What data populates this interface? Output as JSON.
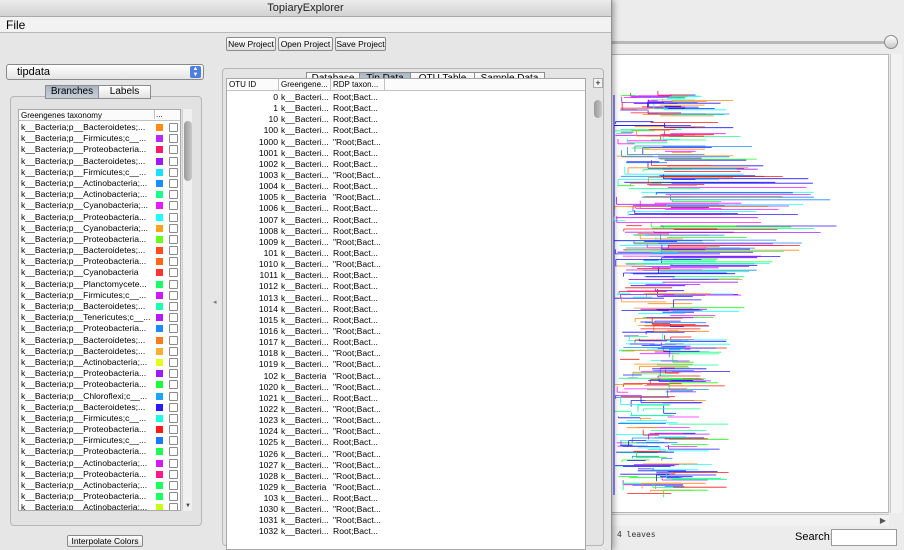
{
  "tree_window": {
    "leaves_label": "4 leaves",
    "search_label": "Search:",
    "search_value": ""
  },
  "main_window": {
    "title": "TopiaryExplorer",
    "menu": {
      "file": "File"
    },
    "toolbar": {
      "new_project": "New Project",
      "open_project": "Open Project",
      "save_project": "Save Project"
    }
  },
  "left_panel": {
    "dataset_select": {
      "value": "tipdata"
    },
    "tabs": [
      {
        "label": "Branches",
        "active": true
      },
      {
        "label": "Labels",
        "active": false
      }
    ],
    "table": {
      "header": {
        "taxonomy": "Greengenes taxonomy",
        "color": "..."
      },
      "rows": [
        {
          "name": "k__Bacteria;p__Bacteroidetes;...",
          "color": "#ff8c1a"
        },
        {
          "name": "k__Bacteria;p__Firmicutes;c__...",
          "color": "#b829ff"
        },
        {
          "name": "k__Bacteria;p__Proteobacteria...",
          "color": "#ff1a66"
        },
        {
          "name": "k__Bacteria;p__Bacteroidetes;...",
          "color": "#9b1aff"
        },
        {
          "name": "k__Bacteria;p__Firmicutes;c__...",
          "color": "#1ae0ff"
        },
        {
          "name": "k__Bacteria;p__Actinobacteria;...",
          "color": "#1a8cff"
        },
        {
          "name": "k__Bacteria;p__Actinobacteria;...",
          "color": "#1aff8c"
        },
        {
          "name": "k__Bacteria;p__Cyanobacteria;...",
          "color": "#e61aff"
        },
        {
          "name": "k__Bacteria;p__Proteobacteria...",
          "color": "#1affff"
        },
        {
          "name": "k__Bacteria;p__Cyanobacteria;...",
          "color": "#ffa31a"
        },
        {
          "name": "k__Bacteria;p__Proteobacteria...",
          "color": "#66ff1a"
        },
        {
          "name": "k__Bacteria;p__Bacteroidetes;...",
          "color": "#ff4d1a"
        },
        {
          "name": "k__Bacteria;p__Proteobacteria...",
          "color": "#ff661a"
        },
        {
          "name": "k__Bacteria;p__Cyanobacteria",
          "color": "#ff3333"
        },
        {
          "name": "k__Bacteria;p__Planctomycete...",
          "color": "#1aff66"
        },
        {
          "name": "k__Bacteria;p__Firmicutes;c__...",
          "color": "#cc1aff"
        },
        {
          "name": "k__Bacteria;p__Bacteroidetes;...",
          "color": "#1affb3"
        },
        {
          "name": "k__Bacteria;p__Tenericutes;c__...",
          "color": "#b31aff"
        },
        {
          "name": "k__Bacteria;p__Proteobacteria...",
          "color": "#1a8cff"
        },
        {
          "name": "k__Bacteria;p__Bacteroidetes;...",
          "color": "#ff7a1a"
        },
        {
          "name": "k__Bacteria;p__Bacteroidetes;...",
          "color": "#ffad33"
        },
        {
          "name": "k__Bacteria;p__Actinobacteria;...",
          "color": "#e6ff1a"
        },
        {
          "name": "k__Bacteria;p__Proteobacteria...",
          "color": "#9d1aff"
        },
        {
          "name": "k__Bacteria;p__Proteobacteria...",
          "color": "#1aff3c"
        },
        {
          "name": "k__Bacteria;p__Chloroflexi;c__...",
          "color": "#1aa3ff"
        },
        {
          "name": "k__Bacteria;p__Bacteroidetes;...",
          "color": "#2b1aff"
        },
        {
          "name": "k__Bacteria;p__Firmicutes;c__...",
          "color": "#1affe0"
        },
        {
          "name": "k__Bacteria;p__Proteobacteria...",
          "color": "#ff1a1a"
        },
        {
          "name": "k__Bacteria;p__Firmicutes;c__...",
          "color": "#1a7aff"
        },
        {
          "name": "k__Bacteria;p__Proteobacteria...",
          "color": "#1aff52"
        },
        {
          "name": "k__Bacteria;p__Actinobacteria;...",
          "color": "#d11aff"
        },
        {
          "name": "k__Bacteria;p__Proteobacteria...",
          "color": "#ff1a8c"
        },
        {
          "name": "k__Bacteria;p__Actinobacteria;...",
          "color": "#1aff5c"
        },
        {
          "name": "k__Bacteria;p__Proteobacteria...",
          "color": "#1aff66"
        },
        {
          "name": "k__Bacteria;p__Actinobacteria;...",
          "color": "#c8ff1a"
        }
      ]
    },
    "interpolate_button": "Interpolate Colors"
  },
  "right_panel": {
    "tabs": [
      {
        "label": "Database",
        "active": false
      },
      {
        "label": "Tip Data",
        "active": true
      },
      {
        "label": "OTU Table",
        "active": false
      },
      {
        "label": "Sample Data",
        "active": false
      }
    ],
    "table": {
      "header": {
        "otu_id": "OTU ID",
        "greengenes": "Greengene...",
        "rdp": "RDP taxon..."
      },
      "rows": [
        {
          "id": "0",
          "gg": "k__Bacteri...",
          "rdp": "Root;Bact..."
        },
        {
          "id": "1",
          "gg": "k__Bacteri...",
          "rdp": "Root;Bact..."
        },
        {
          "id": "10",
          "gg": "k__Bacteri...",
          "rdp": "Root;Bact..."
        },
        {
          "id": "100",
          "gg": "k__Bacteri...",
          "rdp": "Root;Bact..."
        },
        {
          "id": "1000",
          "gg": "k__Bacteri...",
          "rdp": "\"Root;Bact..."
        },
        {
          "id": "1001",
          "gg": "k__Bacteri...",
          "rdp": "Root;Bact..."
        },
        {
          "id": "1002",
          "gg": "k__Bacteri...",
          "rdp": "Root;Bact..."
        },
        {
          "id": "1003",
          "gg": "k__Bacteri...",
          "rdp": "\"Root;Bact..."
        },
        {
          "id": "1004",
          "gg": "k__Bacteri...",
          "rdp": "Root;Bact..."
        },
        {
          "id": "1005",
          "gg": "k__Bacteria",
          "rdp": "\"Root;Bact..."
        },
        {
          "id": "1006",
          "gg": "k__Bacteri...",
          "rdp": "Root;Bact..."
        },
        {
          "id": "1007",
          "gg": "k__Bacteri...",
          "rdp": "Root;Bact..."
        },
        {
          "id": "1008",
          "gg": "k__Bacteri...",
          "rdp": "Root;Bact..."
        },
        {
          "id": "1009",
          "gg": "k__Bacteri...",
          "rdp": "\"Root;Bact..."
        },
        {
          "id": "101",
          "gg": "k__Bacteri...",
          "rdp": "Root;Bact..."
        },
        {
          "id": "1010",
          "gg": "k__Bacteri...",
          "rdp": "\"Root;Bact..."
        },
        {
          "id": "1011",
          "gg": "k__Bacteri...",
          "rdp": "Root;Bact..."
        },
        {
          "id": "1012",
          "gg": "k__Bacteri...",
          "rdp": "Root;Bact..."
        },
        {
          "id": "1013",
          "gg": "k__Bacteri...",
          "rdp": "Root;Bact..."
        },
        {
          "id": "1014",
          "gg": "k__Bacteri...",
          "rdp": "Root;Bact..."
        },
        {
          "id": "1015",
          "gg": "k__Bacteri...",
          "rdp": "Root;Bact..."
        },
        {
          "id": "1016",
          "gg": "k__Bacteri...",
          "rdp": "\"Root;Bact..."
        },
        {
          "id": "1017",
          "gg": "k__Bacteri...",
          "rdp": "Root;Bact..."
        },
        {
          "id": "1018",
          "gg": "k__Bacteri...",
          "rdp": "\"Root;Bact..."
        },
        {
          "id": "1019",
          "gg": "k__Bacteri...",
          "rdp": "\"Root;Bact..."
        },
        {
          "id": "102",
          "gg": "k__Bacteria",
          "rdp": "\"Root;Bact..."
        },
        {
          "id": "1020",
          "gg": "k__Bacteri...",
          "rdp": "\"Root;Bact..."
        },
        {
          "id": "1021",
          "gg": "k__Bacteri...",
          "rdp": "Root;Bact..."
        },
        {
          "id": "1022",
          "gg": "k__Bacteri...",
          "rdp": "\"Root;Bact..."
        },
        {
          "id": "1023",
          "gg": "k__Bacteri...",
          "rdp": "\"Root;Bact..."
        },
        {
          "id": "1024",
          "gg": "k__Bacteri...",
          "rdp": "\"Root;Bact..."
        },
        {
          "id": "1025",
          "gg": "k__Bacteri...",
          "rdp": "Root;Bact..."
        },
        {
          "id": "1026",
          "gg": "k__Bacteri...",
          "rdp": "\"Root;Bact..."
        },
        {
          "id": "1027",
          "gg": "k__Bacteri...",
          "rdp": "\"Root;Bact..."
        },
        {
          "id": "1028",
          "gg": "k__Bacteri...",
          "rdp": "\"Root;Bact..."
        },
        {
          "id": "1029",
          "gg": "k__Bacteria",
          "rdp": "\"Root;Bact..."
        },
        {
          "id": "103",
          "gg": "k__Bacteri...",
          "rdp": "Root;Bact..."
        },
        {
          "id": "1030",
          "gg": "k__Bacteri...",
          "rdp": "\"Root;Bact..."
        },
        {
          "id": "1031",
          "gg": "k__Bacteri...",
          "rdp": "\"Root;Bact..."
        },
        {
          "id": "1032",
          "gg": "k__Bacteri...",
          "rdp": "Root;Bact..."
        }
      ]
    }
  },
  "tree_palette": [
    "#1aff1a",
    "#ff1a1a",
    "#1a1aff",
    "#ff1aff",
    "#1affff",
    "#b31aff",
    "#1aff8c",
    "#ff8c1a",
    "#2b1aff",
    "#1a8cff"
  ]
}
